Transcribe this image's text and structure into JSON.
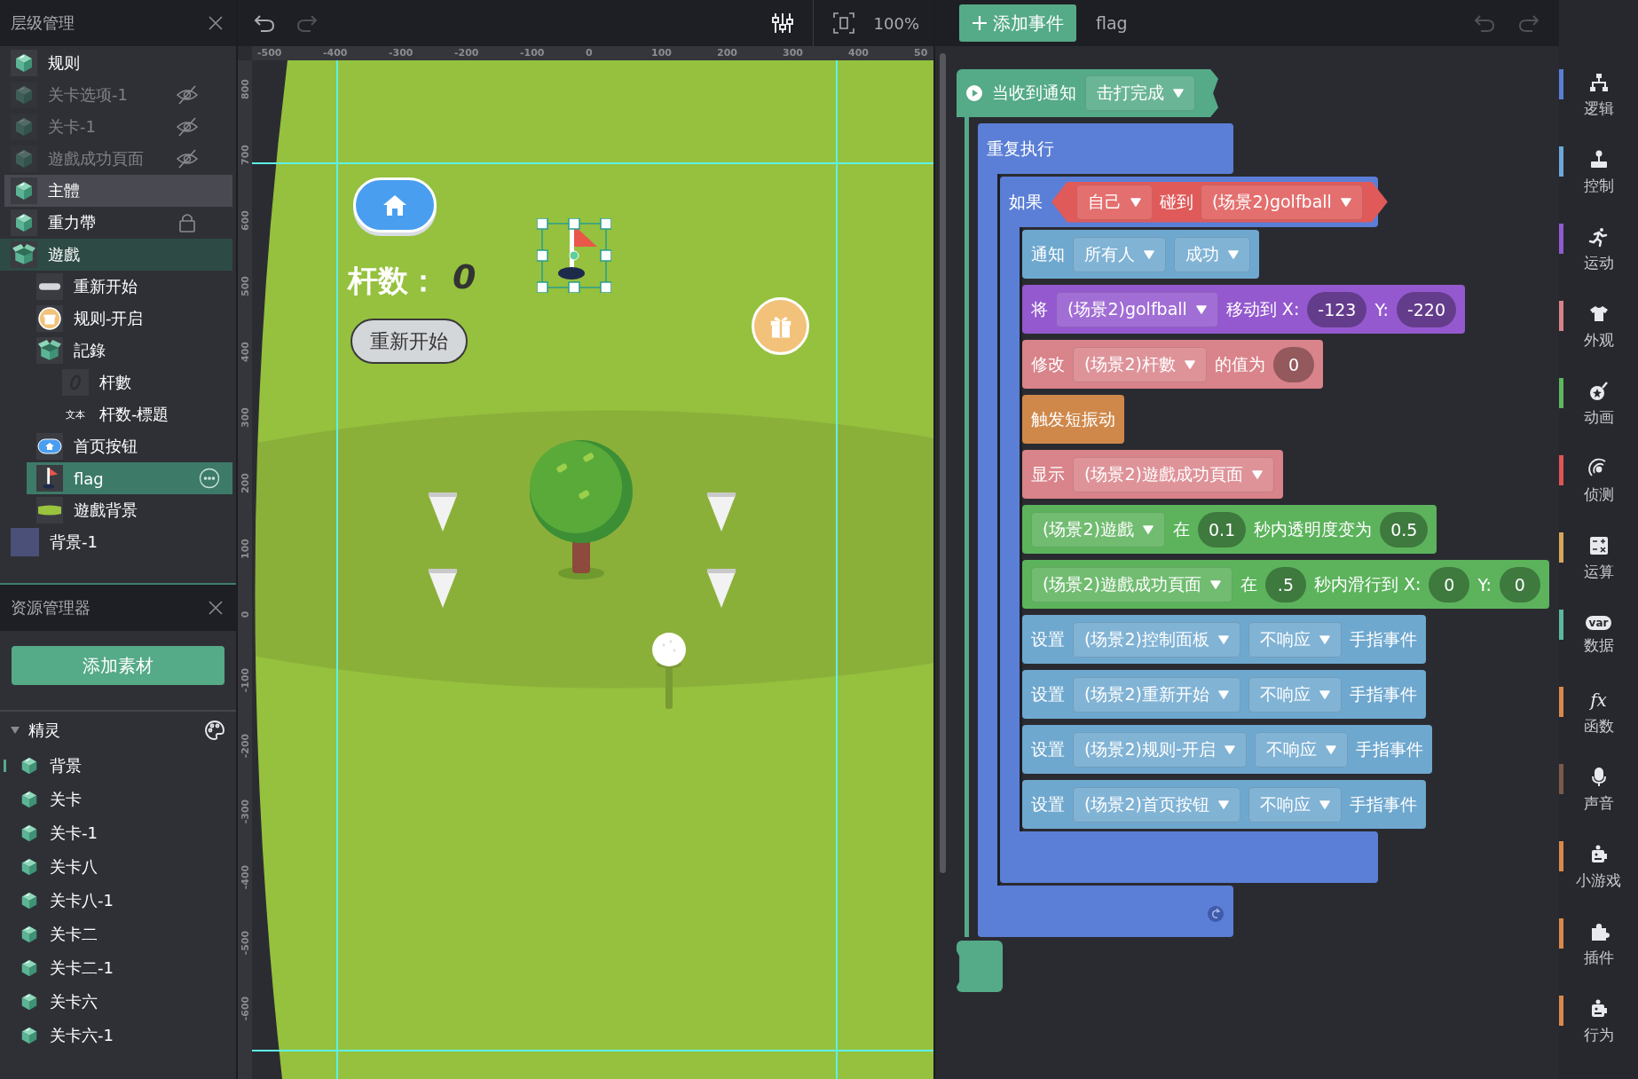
{
  "layers_panel": {
    "title": "层级管理",
    "items": [
      {
        "label": "规则",
        "kind": "cube",
        "selected": false,
        "hovered": false,
        "highlighted": false,
        "hidden": false,
        "locked": false
      },
      {
        "label": "关卡选项-1",
        "kind": "cube",
        "selected": false,
        "hovered": false,
        "highlighted": false,
        "hidden": true,
        "locked": false
      },
      {
        "label": "关卡-1",
        "kind": "cube",
        "selected": false,
        "hovered": false,
        "highlighted": false,
        "hidden": true,
        "locked": false
      },
      {
        "label": "遊戲成功頁面",
        "kind": "cube",
        "selected": false,
        "hovered": false,
        "highlighted": false,
        "hidden": true,
        "locked": false
      },
      {
        "label": "主體",
        "kind": "cube",
        "selected": false,
        "hovered": true,
        "highlighted": false,
        "hidden": false,
        "locked": false
      },
      {
        "label": "重力帶",
        "kind": "cube",
        "selected": false,
        "hovered": false,
        "highlighted": false,
        "hidden": false,
        "locked": true
      },
      {
        "label": "遊戲",
        "kind": "open-box",
        "selected": false,
        "hovered": false,
        "highlighted": true,
        "hidden": false,
        "locked": false,
        "expanded": true,
        "children": [
          {
            "label": "重新开始",
            "kind": "pill",
            "selected": false,
            "hovered": false,
            "highlighted": false,
            "hidden": false,
            "locked": false
          },
          {
            "label": "规则-开启",
            "kind": "gift",
            "selected": false,
            "hovered": false,
            "highlighted": false,
            "hidden": false,
            "locked": false
          },
          {
            "label": "記錄",
            "kind": "open-box",
            "selected": false,
            "hovered": false,
            "highlighted": false,
            "hidden": false,
            "locked": false,
            "expanded": true,
            "children": [
              {
                "label": "杆數",
                "kind": "digit",
                "selected": false,
                "hovered": false,
                "highlighted": false,
                "hidden": false,
                "locked": false
              },
              {
                "label": "杆数-標題",
                "kind": "text",
                "thumb_text": "文本",
                "selected": false,
                "hovered": false,
                "highlighted": false,
                "hidden": false,
                "locked": false
              }
            ]
          },
          {
            "label": "首页按钮",
            "kind": "home",
            "selected": false,
            "hovered": false,
            "highlighted": false,
            "hidden": false,
            "locked": false
          },
          {
            "label": "flag",
            "kind": "flag",
            "selected": true,
            "hovered": false,
            "highlighted": false,
            "hidden": false,
            "locked": false
          },
          {
            "label": "遊戲背景",
            "kind": "ellipse",
            "selected": false,
            "hovered": false,
            "highlighted": false,
            "hidden": false,
            "locked": false
          }
        ]
      },
      {
        "label": "背景-1",
        "kind": "swatch",
        "selected": false,
        "hovered": false,
        "highlighted": false,
        "hidden": false,
        "locked": false
      }
    ]
  },
  "assets_panel": {
    "title": "资源管理器",
    "add_button": "添加素材",
    "section": {
      "title": "精灵",
      "expanded": true,
      "items": [
        {
          "label": "背景",
          "selected": true
        },
        {
          "label": "关卡",
          "selected": false
        },
        {
          "label": "关卡-1",
          "selected": false
        },
        {
          "label": "关卡八",
          "selected": false
        },
        {
          "label": "关卡八-1",
          "selected": false
        },
        {
          "label": "关卡二",
          "selected": false
        },
        {
          "label": "关卡二-1",
          "selected": false
        },
        {
          "label": "关卡六",
          "selected": false
        },
        {
          "label": "关卡六-1",
          "selected": false
        }
      ]
    }
  },
  "canvas": {
    "toolbar": {
      "undo_enabled": true,
      "redo_enabled": false,
      "zoom": "100%"
    },
    "ruler": {
      "x_labels": [
        "-500",
        "-400",
        "-300",
        "-200",
        "-100",
        "0",
        "100",
        "200",
        "300",
        "400",
        "50"
      ],
      "y_labels": [
        "800",
        "700",
        "600",
        "500",
        "400",
        "300",
        "200",
        "100",
        "0",
        "-100",
        "-200",
        "-300",
        "-400",
        "-500",
        "-600"
      ]
    },
    "stage": {
      "score_label": "杆数：",
      "score": "0",
      "restart_button": "重新开始",
      "flag_selected": true
    }
  },
  "block_editor": {
    "add_event": "添加事件",
    "target": "flag",
    "script": {
      "kind": "hat",
      "color": "#55aa88",
      "parts": [
        {
          "kind": "text",
          "text": "当收到通知"
        },
        {
          "kind": "dropdown",
          "text": "击打完成"
        }
      ],
      "body": [
        {
          "kind": "forever",
          "color": "#5b7fd6",
          "parts": [
            {
              "kind": "text",
              "text": "重复执行"
            }
          ],
          "body": [
            {
              "kind": "if",
              "color": "#5b7fd6",
              "parts": [
                {
                  "kind": "text",
                  "text": "如果"
                }
              ],
              "condition": {
                "color": "#e05a5a",
                "parts": [
                  {
                    "kind": "dropdown",
                    "text": "自己"
                  },
                  {
                    "kind": "text",
                    "text": "碰到"
                  },
                  {
                    "kind": "dropdown",
                    "text": "(场景2)golfball"
                  }
                ]
              },
              "body": [
                {
                  "kind": "statement",
                  "color": "#6fa8cf",
                  "parts": [
                    {
                      "kind": "text",
                      "text": "通知"
                    },
                    {
                      "kind": "dropdown",
                      "text": "所有人"
                    },
                    {
                      "kind": "dropdown",
                      "text": "成功"
                    }
                  ]
                },
                {
                  "kind": "statement",
                  "color": "#9459cf",
                  "parts": [
                    {
                      "kind": "text",
                      "text": "将"
                    },
                    {
                      "kind": "dropdown",
                      "text": "(场景2)golfball"
                    },
                    {
                      "kind": "text",
                      "text": "移动到 X:"
                    },
                    {
                      "kind": "number",
                      "text": "-123"
                    },
                    {
                      "kind": "text",
                      "text": "Y:"
                    },
                    {
                      "kind": "number",
                      "text": "-220"
                    }
                  ]
                },
                {
                  "kind": "statement",
                  "color": "#d9838a",
                  "parts": [
                    {
                      "kind": "text",
                      "text": "修改"
                    },
                    {
                      "kind": "dropdown",
                      "text": "(场景2)杆數"
                    },
                    {
                      "kind": "text",
                      "text": "的值为"
                    },
                    {
                      "kind": "number",
                      "text": "0"
                    }
                  ]
                },
                {
                  "kind": "statement",
                  "color": "#cf884a",
                  "parts": [
                    {
                      "kind": "text",
                      "text": "触发短振动"
                    }
                  ]
                },
                {
                  "kind": "statement",
                  "color": "#d9838a",
                  "parts": [
                    {
                      "kind": "text",
                      "text": "显示"
                    },
                    {
                      "kind": "dropdown",
                      "text": "(场景2)遊戲成功頁面"
                    }
                  ]
                },
                {
                  "kind": "statement",
                  "color": "#5cb35c",
                  "parts": [
                    {
                      "kind": "dropdown",
                      "text": "(场景2)遊戲"
                    },
                    {
                      "kind": "text",
                      "text": "在"
                    },
                    {
                      "kind": "number",
                      "text": "0.1"
                    },
                    {
                      "kind": "text",
                      "text": "秒内透明度变为"
                    },
                    {
                      "kind": "number",
                      "text": "0.5"
                    }
                  ]
                },
                {
                  "kind": "statement",
                  "color": "#5cb35c",
                  "parts": [
                    {
                      "kind": "dropdown",
                      "text": "(场景2)遊戲成功頁面"
                    },
                    {
                      "kind": "text",
                      "text": "在"
                    },
                    {
                      "kind": "number",
                      "text": ".5"
                    },
                    {
                      "kind": "text",
                      "text": "秒内滑行到 X:"
                    },
                    {
                      "kind": "number",
                      "text": "0"
                    },
                    {
                      "kind": "text",
                      "text": "Y:"
                    },
                    {
                      "kind": "number",
                      "text": "0"
                    }
                  ]
                },
                {
                  "kind": "statement",
                  "color": "#6fa8cf",
                  "parts": [
                    {
                      "kind": "text",
                      "text": "设置"
                    },
                    {
                      "kind": "dropdown",
                      "text": "(场景2)控制面板"
                    },
                    {
                      "kind": "dropdown",
                      "text": "不响应"
                    },
                    {
                      "kind": "text",
                      "text": "手指事件"
                    }
                  ]
                },
                {
                  "kind": "statement",
                  "color": "#6fa8cf",
                  "parts": [
                    {
                      "kind": "text",
                      "text": "设置"
                    },
                    {
                      "kind": "dropdown",
                      "text": "(场景2)重新开始"
                    },
                    {
                      "kind": "dropdown",
                      "text": "不响应"
                    },
                    {
                      "kind": "text",
                      "text": "手指事件"
                    }
                  ]
                },
                {
                  "kind": "statement",
                  "color": "#6fa8cf",
                  "parts": [
                    {
                      "kind": "text",
                      "text": "设置"
                    },
                    {
                      "kind": "dropdown",
                      "text": "(场景2)规则-开启"
                    },
                    {
                      "kind": "dropdown",
                      "text": "不响应"
                    },
                    {
                      "kind": "text",
                      "text": "手指事件"
                    }
                  ]
                },
                {
                  "kind": "statement",
                  "color": "#6fa8cf",
                  "parts": [
                    {
                      "kind": "text",
                      "text": "设置"
                    },
                    {
                      "kind": "dropdown",
                      "text": "(场景2)首页按钮"
                    },
                    {
                      "kind": "dropdown",
                      "text": "不响应"
                    },
                    {
                      "kind": "text",
                      "text": "手指事件"
                    }
                  ]
                }
              ]
            }
          ]
        }
      ]
    }
  },
  "categories": [
    {
      "label": "逻辑",
      "kind": "logic",
      "color": "#5b7fd6"
    },
    {
      "label": "控制",
      "kind": "control",
      "color": "#6aa9d8"
    },
    {
      "label": "运动",
      "kind": "motion",
      "color": "#8e5bd0"
    },
    {
      "label": "外观",
      "kind": "looks",
      "color": "#d9828a"
    },
    {
      "label": "动画",
      "kind": "animation",
      "color": "#5cb85c"
    },
    {
      "label": "侦测",
      "kind": "sensing",
      "color": "#e05555"
    },
    {
      "label": "运算",
      "kind": "operators",
      "color": "#d9a75a"
    },
    {
      "label": "数据",
      "kind": "data",
      "color": "#5cb8a0",
      "icon_text": "var"
    },
    {
      "label": "函数",
      "kind": "functions",
      "color": "#d9894a",
      "icon_text": "fx"
    },
    {
      "label": "声音",
      "kind": "sound",
      "color": "#7a5a4a"
    },
    {
      "label": "小游戏",
      "kind": "minigame",
      "color": "#d9894a"
    },
    {
      "label": "插件",
      "kind": "plugin",
      "color": "#d9894a"
    },
    {
      "label": "行为",
      "kind": "behavior",
      "color": "#d9894a"
    }
  ]
}
